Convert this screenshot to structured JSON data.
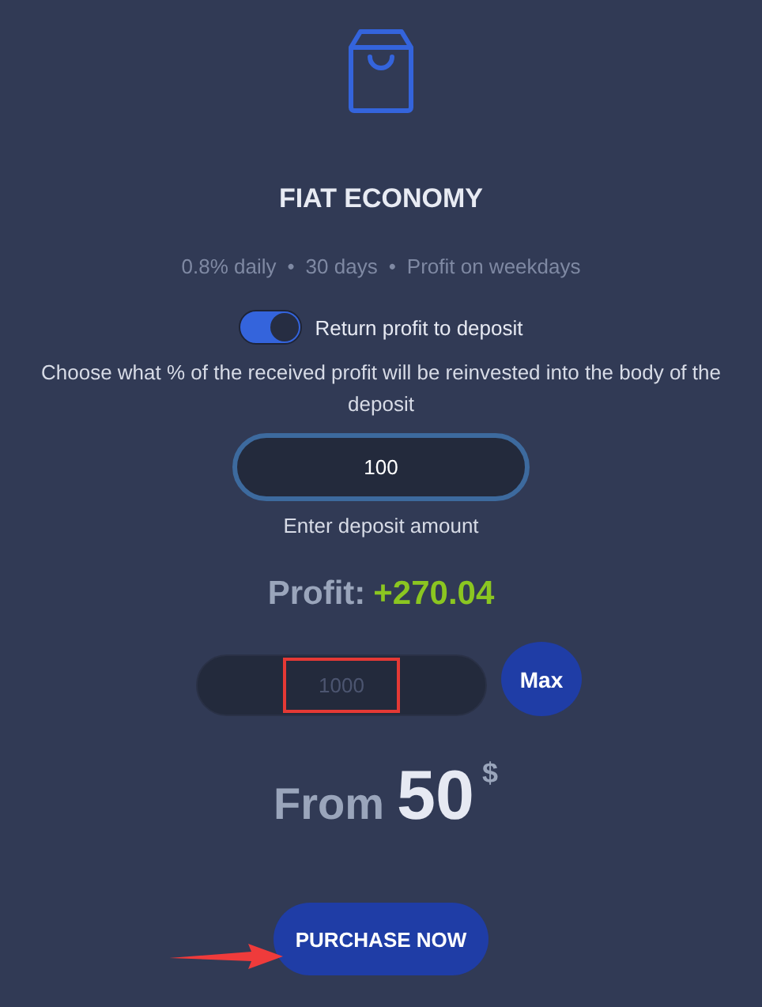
{
  "plan": {
    "title": "FIAT ECONOMY",
    "details": [
      "0.8% daily",
      "30 days",
      "Profit on weekdays"
    ],
    "separator": "•"
  },
  "reinvest_toggle": {
    "label": "Return profit to deposit",
    "on": true
  },
  "reinvest_hint": "Choose what % of the received profit will be reinvested into the body of the deposit",
  "reinvest_field": {
    "value": "100"
  },
  "deposit_hint": "Enter deposit amount",
  "profit": {
    "label": "Profit:",
    "value": "+270.04"
  },
  "amount_field": {
    "placeholder": "1000",
    "highlighted": true
  },
  "max_button": "Max",
  "minimum": {
    "label": "From",
    "amount": "50",
    "currency": "$"
  },
  "purchase_button": "PURCHASE NOW",
  "pointer_arrow": true
}
